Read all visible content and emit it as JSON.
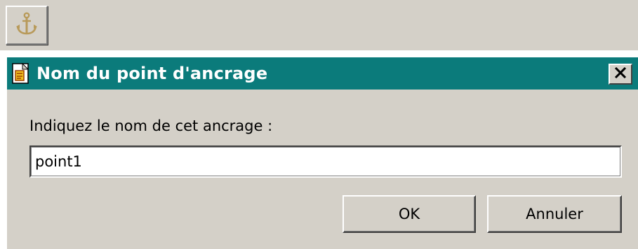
{
  "toolbar": {
    "anchor_button_icon": "anchor-icon"
  },
  "dialog": {
    "title": "Nom du point d'ancrage",
    "title_icon": "document-icon",
    "close_icon": "close-icon",
    "prompt": "Indiquez le nom de cet ancrage :",
    "input_value": "point1",
    "ok_label": "OK",
    "cancel_label": "Annuler"
  },
  "colors": {
    "titlebar": "#0b7b7b",
    "face": "#d4d0c8",
    "anchor": "#b89a5a"
  }
}
